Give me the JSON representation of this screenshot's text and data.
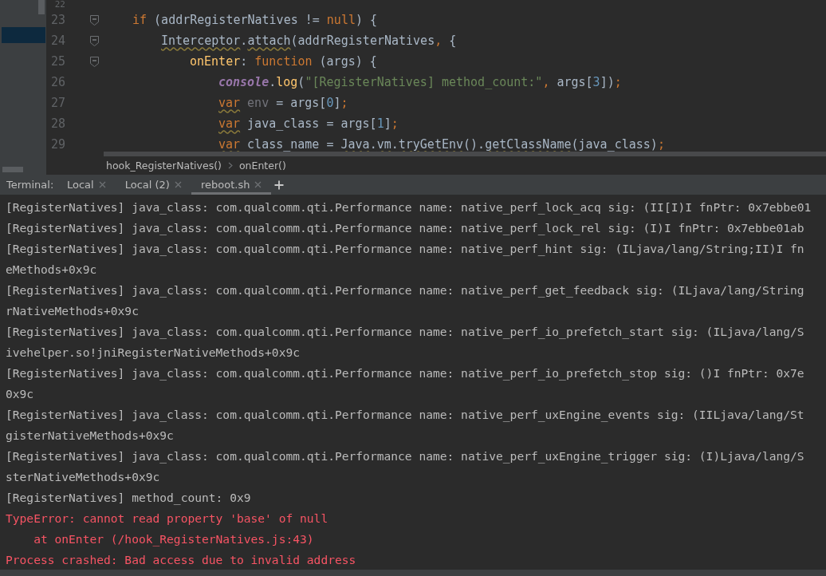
{
  "editor": {
    "lines": [
      {
        "number": "22",
        "fold": false
      },
      {
        "number": "23",
        "fold": true,
        "tokens": [
          {
            "kind": "keyword",
            "text": "if"
          },
          {
            "kind": "plain",
            "text": " (addrRegisterNatives != "
          },
          {
            "kind": "keyword",
            "text": "null"
          },
          {
            "kind": "plain",
            "text": ") {"
          }
        ],
        "children": [
          {
            "number": "24",
            "fold": true,
            "tokens": [
              {
                "kind": "warn_plain",
                "text": "Interceptor"
              },
              {
                "kind": "plain",
                "text": "."
              },
              {
                "kind": "warn_plain",
                "text": "attach"
              },
              {
                "kind": "plain",
                "text": "(addrRegisterNatives"
              },
              {
                "kind": "keyword",
                "text": ","
              },
              {
                "kind": "plain",
                "text": " {"
              }
            ],
            "children": [
              {
                "number": "25",
                "fold": true,
                "tokens": [
                  {
                    "kind": "function",
                    "text": "onEnter"
                  },
                  {
                    "kind": "plain",
                    "text": ": "
                  },
                  {
                    "kind": "keyword",
                    "text": "function"
                  },
                  {
                    "kind": "plain",
                    "text": " (args) {"
                  }
                ],
                "children": [
                  {
                    "number": "26",
                    "fold": false,
                    "tokens": [
                      {
                        "kind": "global",
                        "text": "console"
                      },
                      {
                        "kind": "plain",
                        "text": "."
                      },
                      {
                        "kind": "function",
                        "text": "log"
                      },
                      {
                        "kind": "plain",
                        "text": "("
                      },
                      {
                        "kind": "string",
                        "text": "\"[RegisterNatives] method_count:\""
                      },
                      {
                        "kind": "keyword",
                        "text": ","
                      },
                      {
                        "kind": "plain",
                        "text": " args["
                      },
                      {
                        "kind": "number",
                        "text": "3"
                      },
                      {
                        "kind": "plain",
                        "text": "])"
                      },
                      {
                        "kind": "keyword",
                        "text": ";"
                      }
                    ]
                  },
                  {
                    "number": "27",
                    "fold": false,
                    "tokens": [
                      {
                        "kind": "warn_keyword",
                        "text": "var"
                      },
                      {
                        "kind": "unused",
                        "text": "env"
                      },
                      {
                        "kind": "plain",
                        "text": "= args["
                      },
                      {
                        "kind": "number",
                        "text": "0"
                      },
                      {
                        "kind": "plain",
                        "text": "]"
                      },
                      {
                        "kind": "keyword",
                        "text": ";"
                      }
                    ]
                  },
                  {
                    "number": "28",
                    "fold": false,
                    "tokens": [
                      {
                        "kind": "warn_keyword",
                        "text": "var"
                      },
                      {
                        "kind": "plain",
                        "text": "java_class = args["
                      },
                      {
                        "kind": "number",
                        "text": "1"
                      },
                      {
                        "kind": "plain",
                        "text": "]"
                      },
                      {
                        "kind": "keyword",
                        "text": ";"
                      }
                    ]
                  },
                  {
                    "number": "29",
                    "fold": false,
                    "tokens": [
                      {
                        "kind": "warn_keyword",
                        "text": "var"
                      },
                      {
                        "kind": "plain",
                        "text": "class_name = "
                      },
                      {
                        "kind": "warn_plain",
                        "text": "Java"
                      },
                      {
                        "kind": "plain",
                        "text": "."
                      },
                      {
                        "kind": "warn_plain",
                        "text": "vm"
                      },
                      {
                        "kind": "plain",
                        "text": "."
                      },
                      {
                        "kind": "warn_plain",
                        "text": "tryGetEnv"
                      },
                      {
                        "kind": "plain",
                        "text": "()."
                      },
                      {
                        "kind": "warn_plain",
                        "text": "getClassName"
                      },
                      {
                        "kind": "plain",
                        "text": "(java_class)"
                      },
                      {
                        "kind": "keyword",
                        "text": ";"
                      }
                    ]
                  }
                ]
              }
            ]
          }
        ]
      }
    ]
  },
  "breadcrumb": [
    "hook_RegisterNatives()",
    "onEnter()"
  ],
  "terminal": {
    "label": "Terminal:",
    "tabs": [
      {
        "label": "Local",
        "selected": false
      },
      {
        "label": "Local (2)",
        "selected": false
      },
      {
        "label": "reboot.sh",
        "selected": true
      }
    ],
    "lines": [
      {
        "kind": "normal",
        "text": "[RegisterNatives] java_class: com.qualcomm.qti.Performance name: native_perf_lock_acq sig: (II[I)I fnPtr: 0x7ebbe01"
      },
      {
        "kind": "normal",
        "text": "[RegisterNatives] java_class: com.qualcomm.qti.Performance name: native_perf_lock_rel sig: (I)I fnPtr: 0x7ebbe01ab"
      },
      {
        "kind": "normal",
        "text": "[RegisterNatives] java_class: com.qualcomm.qti.Performance name: native_perf_hint sig: (ILjava/lang/String;II)I fn"
      },
      {
        "kind": "normal",
        "text": "eMethods+0x9c"
      },
      {
        "kind": "normal",
        "text": "[RegisterNatives] java_class: com.qualcomm.qti.Performance name: native_perf_get_feedback sig: (ILjava/lang/String"
      },
      {
        "kind": "normal",
        "text": "rNativeMethods+0x9c"
      },
      {
        "kind": "normal",
        "text": "[RegisterNatives] java_class: com.qualcomm.qti.Performance name: native_perf_io_prefetch_start sig: (ILjava/lang/S"
      },
      {
        "kind": "normal",
        "text": "ivehelper.so!jniRegisterNativeMethods+0x9c"
      },
      {
        "kind": "normal",
        "text": "[RegisterNatives] java_class: com.qualcomm.qti.Performance name: native_perf_io_prefetch_stop sig: ()I fnPtr: 0x7e"
      },
      {
        "kind": "normal",
        "text": "0x9c"
      },
      {
        "kind": "normal",
        "text": "[RegisterNatives] java_class: com.qualcomm.qti.Performance name: native_perf_uxEngine_events sig: (IILjava/lang/St"
      },
      {
        "kind": "normal",
        "text": "gisterNativeMethods+0x9c"
      },
      {
        "kind": "normal",
        "text": "[RegisterNatives] java_class: com.qualcomm.qti.Performance name: native_perf_uxEngine_trigger sig: (I)Ljava/lang/S"
      },
      {
        "kind": "normal",
        "text": "sterNativeMethods+0x9c"
      },
      {
        "kind": "normal",
        "text": "[RegisterNatives] method_count: 0x9"
      },
      {
        "kind": "error",
        "text": "TypeError: cannot read property 'base' of null"
      },
      {
        "kind": "error",
        "text": "    at onEnter (/hook_RegisterNatives.js:43)"
      },
      {
        "kind": "error",
        "text": "Process crashed: Bad access due to invalid address"
      }
    ]
  }
}
